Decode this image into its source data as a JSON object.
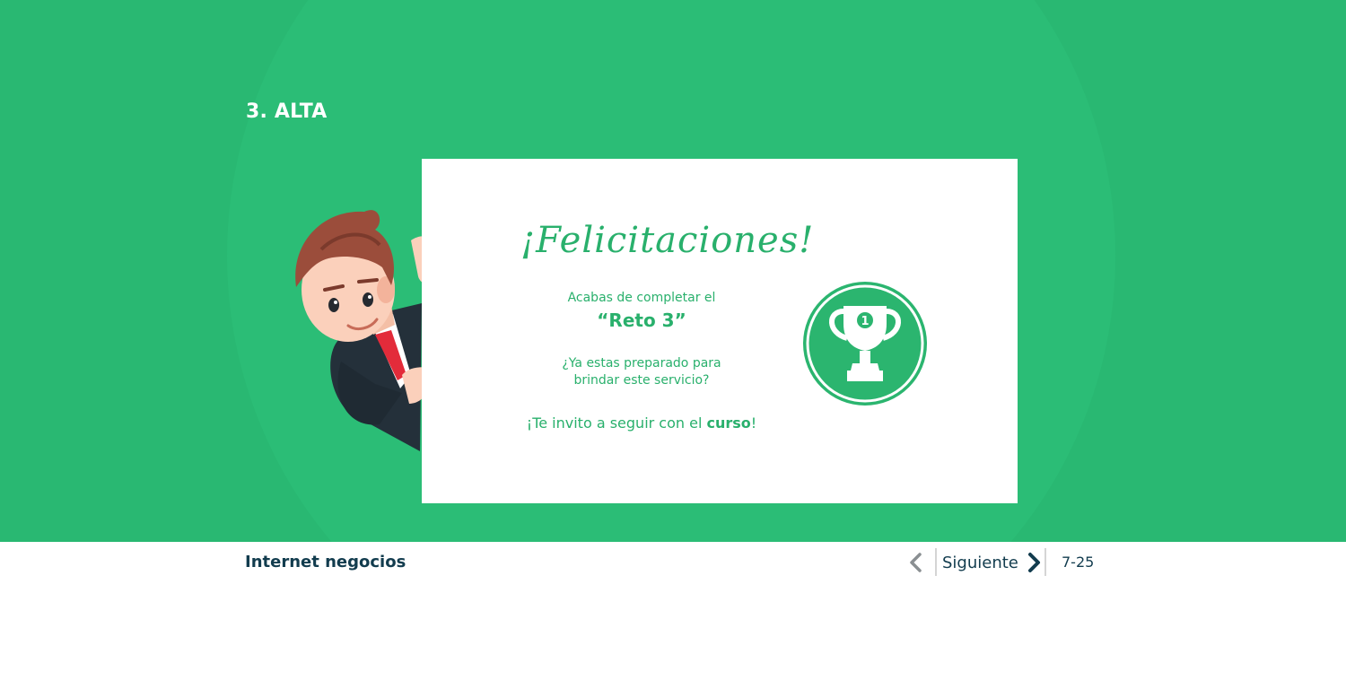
{
  "section": {
    "title": "3. ALTA"
  },
  "card": {
    "congrats": "¡Felicitaciones!",
    "completed_line": "Acabas de completar el",
    "challenge_name": "“Reto 3”",
    "ready_line1": "¿Ya estas preparado para",
    "ready_line2": "brindar este servicio?",
    "invite_prefix": "¡Te invito a seguir con el ",
    "invite_bold": "curso",
    "invite_suffix": "!",
    "trophy_number": "1"
  },
  "footer": {
    "course_title": "Internet negocios",
    "next_label": "Siguiente",
    "page_counter": "7-25"
  },
  "icons": {
    "prev": "chevron-left-icon",
    "next": "chevron-right-icon",
    "trophy": "trophy-icon"
  },
  "colors": {
    "background_green": "#29b872",
    "accent_green": "#29b06c",
    "footer_text": "#123c4e"
  }
}
